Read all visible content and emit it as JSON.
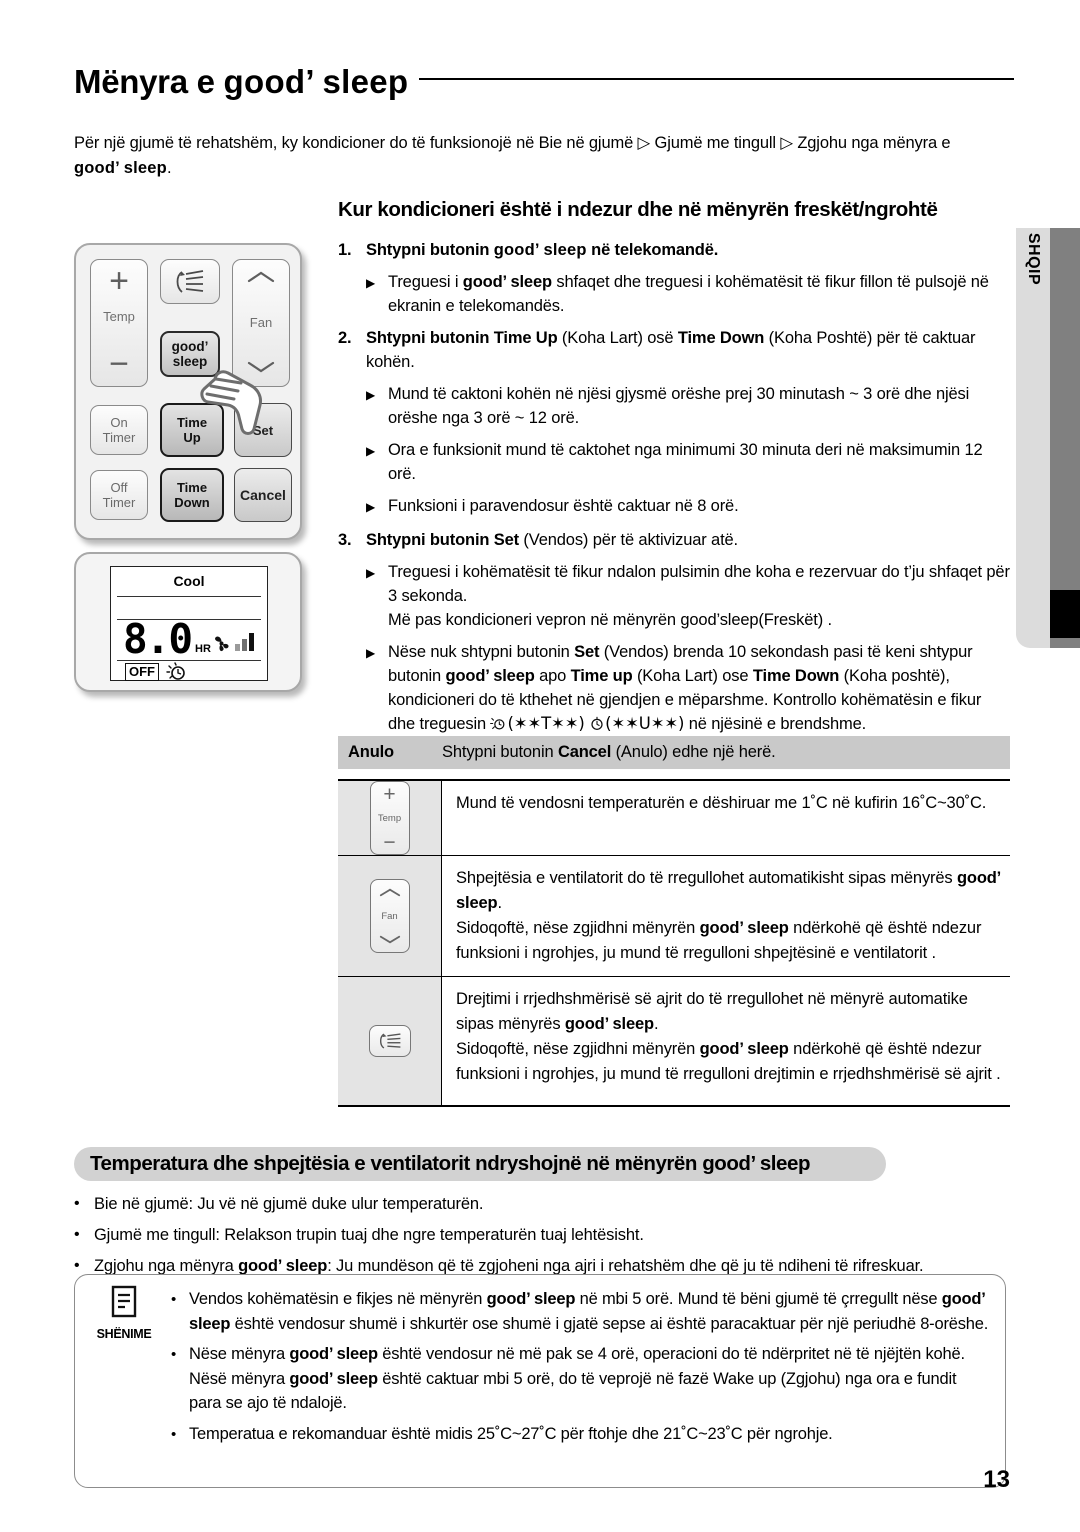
{
  "page": {
    "title_part1": "Mënyra e ",
    "title_brand": "good’ sleep",
    "page_number": "13",
    "language_tab": "SHQIP"
  },
  "intro": {
    "text_a": "Për një gjumë të rehatshëm, ky kondicioner do të funksionojë në Bie në gjumë ",
    "arrow1": "▷",
    "text_b": " Gjumë me tingull ",
    "arrow2": "▷",
    "text_c": " Zgjohu nga mënyra e ",
    "brand": "good’ sleep",
    "text_d": "."
  },
  "remote": {
    "temp_label": "Temp",
    "temp_plus": "+",
    "temp_minus": "−",
    "fan_label": "Fan",
    "good_sleep_line1": "good’",
    "good_sleep_line2": "sleep",
    "on_timer_line1": "On",
    "on_timer_line2": "Timer",
    "time_up_line1": "Time",
    "time_up_line2": "Up",
    "set_label": "Set",
    "off_timer_line1": "Off",
    "off_timer_line2": "Timer",
    "time_down_line1": "Time",
    "time_down_line2": "Down",
    "cancel_label": "Cancel"
  },
  "lcd": {
    "mode": "Cool",
    "value": "8.0",
    "unit": "HR",
    "off_badge": "OFF"
  },
  "main": {
    "heading": "Kur kondicioneri është i ndezur dhe në mënyrën freskët/ngrohtë",
    "steps": [
      {
        "num": "1.",
        "text_a": "Shtypni butonin ",
        "brand": "good’ sleep",
        "text_b": " në telekomandë.",
        "bullets": [
          {
            "a": "Treguesi i ",
            "brand": "good’ sleep",
            "b": " shfaqet dhe treguesi i kohëmatësit të fikur fillon të pulsojë në ekranin e telekomandës."
          }
        ]
      },
      {
        "num": "2.",
        "text_a": "Shtypni butonin ",
        "bold1": "Time Up",
        "text_b": " (Koha Lart) osë ",
        "bold2": "Time Down",
        "text_c": " (Koha Poshtë) për të caktuar kohën.",
        "bullets": [
          {
            "plain": "Mund të caktoni kohën në njësi gjysmë orëshe prej 30 minutash ~ 3 orë dhe njësi orëshe nga 3 orë ~ 12 orë."
          },
          {
            "plain": "Ora e funksionit mund të caktohet nga minimumi 30 minuta deri në maksimumin 12 orë."
          },
          {
            "plain": "Funksioni i paravendosur është caktuar në 8 orë."
          }
        ]
      },
      {
        "num": "3.",
        "text_a": "Shtypni butonin ",
        "bold1": "Set",
        "text_b": " (Vendos) për të aktivizuar atë.",
        "bullets": [
          {
            "plain": "Treguesi i kohëmatësit të fikur ndalon pulsimin dhe koha e rezervuar do t’ju shfaqet për 3 sekonda.\nMë pas kondicioneri vepron në mënyrën good’sleep(Freskët) ."
          }
        ]
      }
    ],
    "final_bullet": {
      "a": "Nëse nuk shtypni butonin ",
      "b1": "Set",
      "b": " (Vendos) brenda 10 sekondash pasi të keni shtypur butonin ",
      "b2": "good’ sleep",
      "c": " apo ",
      "b3": "Time up",
      "d": " (Koha Lart) ose ",
      "b4": "Time Down",
      "e": " (Koha poshtë), kondicioneri do të kthehet në gjendjen e mëparshme.  Kontrollo kohëmatësin e fikur dhe treguesin ",
      "sym1": "(✶✶T✶✶)",
      "sym2": "(✶✶U✶✶)",
      "f": " në njësinë e brendshme."
    }
  },
  "table": {
    "cancel_row": {
      "label": "Anulo",
      "text_a": "Shtypni butonin ",
      "bold": "Cancel",
      "text_b": " (Anulo) edhe një herë."
    },
    "rows": [
      {
        "icon": "temp-stepper-icon",
        "icon_label": "Temp",
        "paragraphs": [
          {
            "plain": "Mund të vendosni temperaturën e dëshiruar me 1˚C në kufirin 16˚C~30˚C."
          }
        ]
      },
      {
        "icon": "fan-stepper-icon",
        "icon_label": "Fan",
        "paragraphs": [
          {
            "a": "Shpejtësia e ventilatorit do të rregullohet automatikisht sipas mënyrës ",
            "brand": "good’ sleep",
            "b": "."
          },
          {
            "a": "Sidoqoftë, nëse zgjidhni mënyrën ",
            "brand": "good’ sleep",
            "b": " ndërkohë që është ndezur funksioni i ngrohjes, ju mund të rregulloni shpejtësinë e ventilatorit ."
          }
        ]
      },
      {
        "icon": "air-swing-icon",
        "icon_label": "",
        "paragraphs": [
          {
            "a": "Drejtimi i rrjedhshmërisë së ajrit do të rregullohet në mënyrë automatike sipas mënyrës ",
            "brand": "good’ sleep",
            "b": "."
          },
          {
            "a": "Sidoqoftë, nëse zgjidhni mënyrën ",
            "brand": "good’ sleep",
            "b": " ndërkohë që është ndezur funksioni i ngrohjes, ju mund të rregulloni drejtimin e rrjedhshmërisë së ajrit ."
          }
        ]
      }
    ]
  },
  "bottom": {
    "heading_a": "Temperatura dhe shpejtësia e ventilatorit ndryshojnë në mënyrën ",
    "heading_brand": "good’ sleep",
    "bullets": [
      {
        "plain": "Bie në gjumë: Ju vë në gjumë duke ulur temperaturën."
      },
      {
        "plain": "Gjumë me tingull: Relakson trupin tuaj dhe ngre temperaturën tuaj lehtësisht."
      },
      {
        "a": "Zgjohu nga mënyra ",
        "brand": "good’ sleep",
        "b": ": Ju mundëson që të zgjoheni nga ajri i rehatshëm dhe që ju të ndiheni të rifreskuar."
      }
    ]
  },
  "note": {
    "label": "SHËNIME",
    "icon": "note-document-icon",
    "bullets": [
      {
        "a": "Vendos kohëmatësin e fikjes në mënyrën  ",
        "brand1": "good’ sleep",
        "b": " në mbi 5 orë. Mund të bëni gjumë të çrregullt nëse ",
        "brand2": "good’ sleep",
        "c": " është vendosur shumë i shkurtër ose shumë i gjatë sepse ai është paracaktuar për një periudhë 8-orëshe."
      },
      {
        "a": "Nëse mënyra ",
        "brand1": "good’ sleep",
        "b": " është vendosur në më pak se 4 orë, operacioni do të ndërpritet në të njëjtën kohë. Nësë mënyra ",
        "brand2": "good’ sleep",
        "c": " është caktuar mbi 5 orë, do të veprojë në fazë Wake up (Zgjohu) nga ora e fundit para se ajo të ndalojë."
      },
      {
        "plain": "Temperatua e rekomanduar është midis 25˚C~27˚C për ftohje dhe 21˚C~23˚C për ngrohje."
      }
    ]
  }
}
